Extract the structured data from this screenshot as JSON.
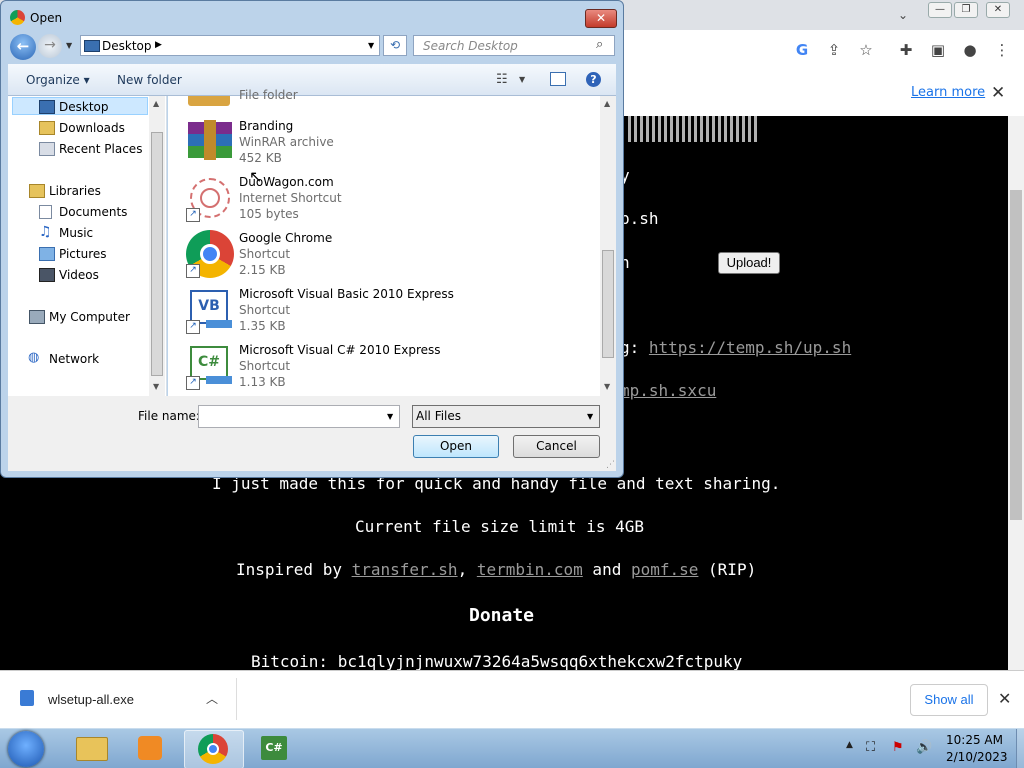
{
  "browser": {
    "infobar": {
      "learn_more": "Learn more",
      "close": "✕"
    },
    "window_controls": {
      "minimize": "—",
      "maximize": "❐",
      "close": "✕"
    }
  },
  "site": {
    "lines": {
      "line1": "y",
      "line2": "p.sh",
      "line3": "n",
      "line4": "g: ",
      "line4_link": "https://temp.sh/up.sh",
      "line5_link": "mp.sh.sxcu",
      "about": "I just made this for quick and handy file and text sharing.",
      "limit": "Current file size limit is 4GB",
      "inspired_prefix": "Inspired by ",
      "inspired_link1": "transfer.sh",
      "inspired_sep1": ", ",
      "inspired_link2": "termbin.com",
      "inspired_sep2": " and ",
      "inspired_link3": "pomf.se",
      "inspired_suffix": " (RIP)",
      "donate": "Donate",
      "bitcoin": "Bitcoin: bc1qlyjnjnwuxw73264a5wsqq6xthekcxw2fctpuky"
    },
    "upload_button": "Upload!"
  },
  "downloads": {
    "file": "wlsetup-all.exe",
    "show_all": "Show all",
    "close": "✕"
  },
  "taskbar": {
    "time": "10:25 AM",
    "date": "2/10/2023"
  },
  "dialog": {
    "title": "Open",
    "close": "✕",
    "address": "Desktop",
    "search_placeholder": "Search Desktop",
    "organize": "Organize ▾",
    "new_folder": "New folder",
    "nav": {
      "desktop": "Desktop",
      "downloads": "Downloads",
      "recent": "Recent Places",
      "libraries": "Libraries",
      "documents": "Documents",
      "music": "Music",
      "pictures": "Pictures",
      "videos": "Videos",
      "computer": "My Computer",
      "network": "Network"
    },
    "files": [
      {
        "name": "",
        "type": "File folder",
        "size": ""
      },
      {
        "name": "Branding",
        "type": "WinRAR archive",
        "size": "452 KB"
      },
      {
        "name": "DuoWagon.com",
        "type": "Internet Shortcut",
        "size": "105 bytes"
      },
      {
        "name": "Google Chrome",
        "type": "Shortcut",
        "size": "2.15 KB"
      },
      {
        "name": "Microsoft Visual Basic 2010 Express",
        "type": "Shortcut",
        "size": "1.35 KB"
      },
      {
        "name": "Microsoft Visual C# 2010 Express",
        "type": "Shortcut",
        "size": "1.13 KB"
      }
    ],
    "file_name_label": "File name:",
    "file_name_value": "",
    "filter": "All Files",
    "open_button": "Open",
    "cancel_button": "Cancel"
  }
}
